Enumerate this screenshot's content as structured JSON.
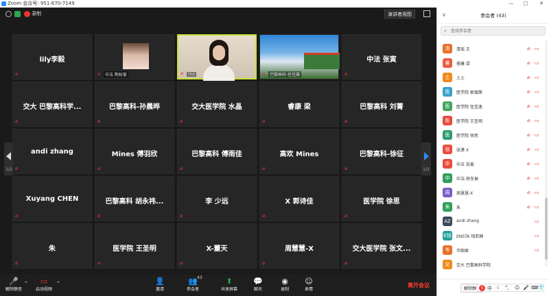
{
  "window": {
    "title": "Zoom 会议号: 951-670-7149",
    "controls": [
      "—",
      "□",
      "✕"
    ]
  },
  "topbar": {
    "recording_label": "录制",
    "speaker_view_label": "演讲者视图"
  },
  "grid": {
    "page_indicator_left": "1/2",
    "page_indicator_right": "1/2",
    "tiles": [
      {
        "name": "lily李毅",
        "type": "name"
      },
      {
        "name": "",
        "caption": "中法 陶秋菊",
        "type": "avatar"
      },
      {
        "name": "",
        "caption": "Hui",
        "type": "video-active"
      },
      {
        "name": "",
        "caption": "巴黎高科-任佳晨",
        "type": "video-bg"
      },
      {
        "name": "中法 张寅",
        "type": "name"
      },
      {
        "name": "交大 巴黎高科学...",
        "type": "name"
      },
      {
        "name": "巴黎高科-孙晨晔",
        "type": "name"
      },
      {
        "name": "交大医学院 水晶",
        "type": "name"
      },
      {
        "name": "睿康 梁",
        "type": "name"
      },
      {
        "name": "巴黎高科 刘菁",
        "type": "name"
      },
      {
        "name": "andi zhang",
        "type": "name"
      },
      {
        "name": "Mines 傅羽欣",
        "type": "name"
      },
      {
        "name": "巴黎高科 傅雨佳",
        "type": "name"
      },
      {
        "name": "高欢 Mines",
        "type": "name"
      },
      {
        "name": "巴黎高科-徐征",
        "type": "name"
      },
      {
        "name": "Xuyang CHEN",
        "type": "name"
      },
      {
        "name": "巴黎高科 胡永祎...",
        "type": "name"
      },
      {
        "name": "李 少远",
        "type": "name"
      },
      {
        "name": "X 郭诗佳",
        "type": "name"
      },
      {
        "name": "医学院 徐思",
        "type": "name"
      },
      {
        "name": "朱",
        "type": "name"
      },
      {
        "name": "医学院 王圣明",
        "type": "name"
      },
      {
        "name": "X-董天",
        "type": "name"
      },
      {
        "name": "周慧慧-X",
        "type": "name"
      },
      {
        "name": "交大医学院 张文...",
        "type": "name"
      }
    ]
  },
  "toolbar": {
    "unmute_label": "解除静音",
    "start_video_label": "启动视频",
    "invite_label": "邀请",
    "participants_label": "参会者",
    "participants_count": "43",
    "share_label": "共享屏幕",
    "chat_label": "聊天",
    "record_label": "录制",
    "reactions_label": "表情",
    "end_label": "离开会议"
  },
  "panel": {
    "title": "参会者 (43)",
    "search_placeholder": "查找参会者",
    "participants": [
      {
        "initial": "清",
        "name": "清瑶 王",
        "color": "#e8712b",
        "muted": true,
        "video_off": true
      },
      {
        "initial": "睿",
        "name": "睿康 梁",
        "color": "#e85d3f",
        "muted": true,
        "video_off": true
      },
      {
        "initial": "土",
        "name": "土土",
        "color": "#f08a1c",
        "muted": true,
        "video_off": true
      },
      {
        "initial": "医",
        "name": "医学院 郭增茜",
        "color": "#3aa0c9",
        "muted": true,
        "video_off": true
      },
      {
        "initial": "医",
        "name": "医学院 任佳逸",
        "color": "#43a55f",
        "muted": true,
        "video_off": true
      },
      {
        "initial": "医",
        "name": "医学院 王圣明",
        "color": "#e74a3c",
        "muted": true,
        "video_off": true
      },
      {
        "initial": "医",
        "name": "医学院 徐思",
        "color": "#2e9d6f",
        "muted": true,
        "video_off": true
      },
      {
        "initial": "张",
        "name": "张潇 X",
        "color": "#e84c3d",
        "muted": true,
        "video_off": true
      },
      {
        "initial": "中",
        "name": "中法 张寅",
        "color": "#e84c3d",
        "muted": true,
        "video_off": true
      },
      {
        "initial": "中",
        "name": "中法-徐东振",
        "color": "#2fa05a",
        "muted": true,
        "video_off": true
      },
      {
        "initial": "周",
        "name": "周慧慧-X",
        "color": "#7a5cc7",
        "muted": true,
        "video_off": true
      },
      {
        "initial": "朱",
        "name": "朱",
        "color": "#2fa05a",
        "muted": true,
        "video_off": true
      },
      {
        "initial": "AZ",
        "name": "andi zhang",
        "color": "#3b4a5a",
        "muted": false,
        "video_off": true
      },
      {
        "initial": "E钱",
        "name": "ENSTA 钱若楠",
        "color": "#27a09a",
        "muted": false,
        "video_off": true
      },
      {
        "initial": "岑",
        "name": "岑韶君",
        "color": "#e8712b",
        "muted": false,
        "video_off": true
      },
      {
        "initial": "交",
        "name": "交大 巴黎高科学院",
        "color": "#f08a1c",
        "muted": false,
        "video_off": false
      }
    ],
    "footer_unmute_all": "解除静音",
    "footer_mute_all": "更多"
  },
  "ime": {
    "logo_letter": "S",
    "mode": "中"
  }
}
